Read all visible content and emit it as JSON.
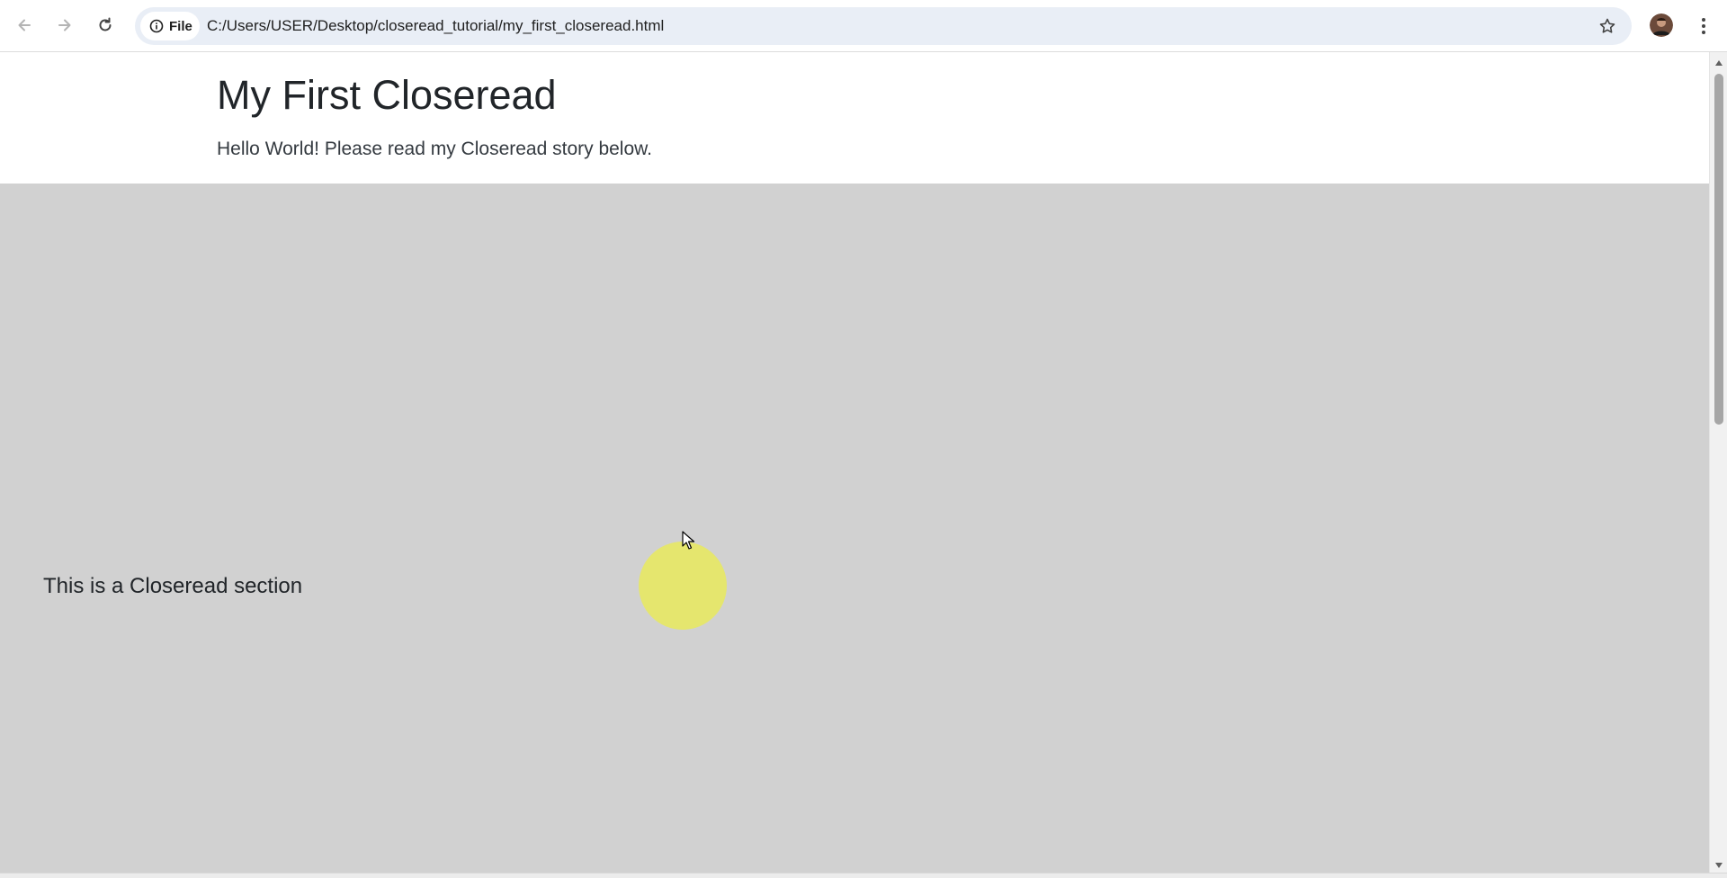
{
  "browser": {
    "site_chip_label": "File",
    "url": "C:/Users/USER/Desktop/closeread_tutorial/my_first_closeread.html",
    "icons": {
      "back": "arrow-left-icon",
      "forward": "arrow-right-icon",
      "reload": "reload-icon",
      "site_info": "info-circle-icon",
      "bookmark": "star-outline-icon",
      "menu": "kebab-menu-icon"
    }
  },
  "page": {
    "title": "My First Closeread",
    "subtitle": "Hello World! Please read my Closeread story below.",
    "closeread_section": {
      "trigger_text": "This is a Closeread section",
      "background_color": "#d1d1d1",
      "sticky_shape": "circle",
      "sticky_color": "#e5e66e"
    }
  }
}
